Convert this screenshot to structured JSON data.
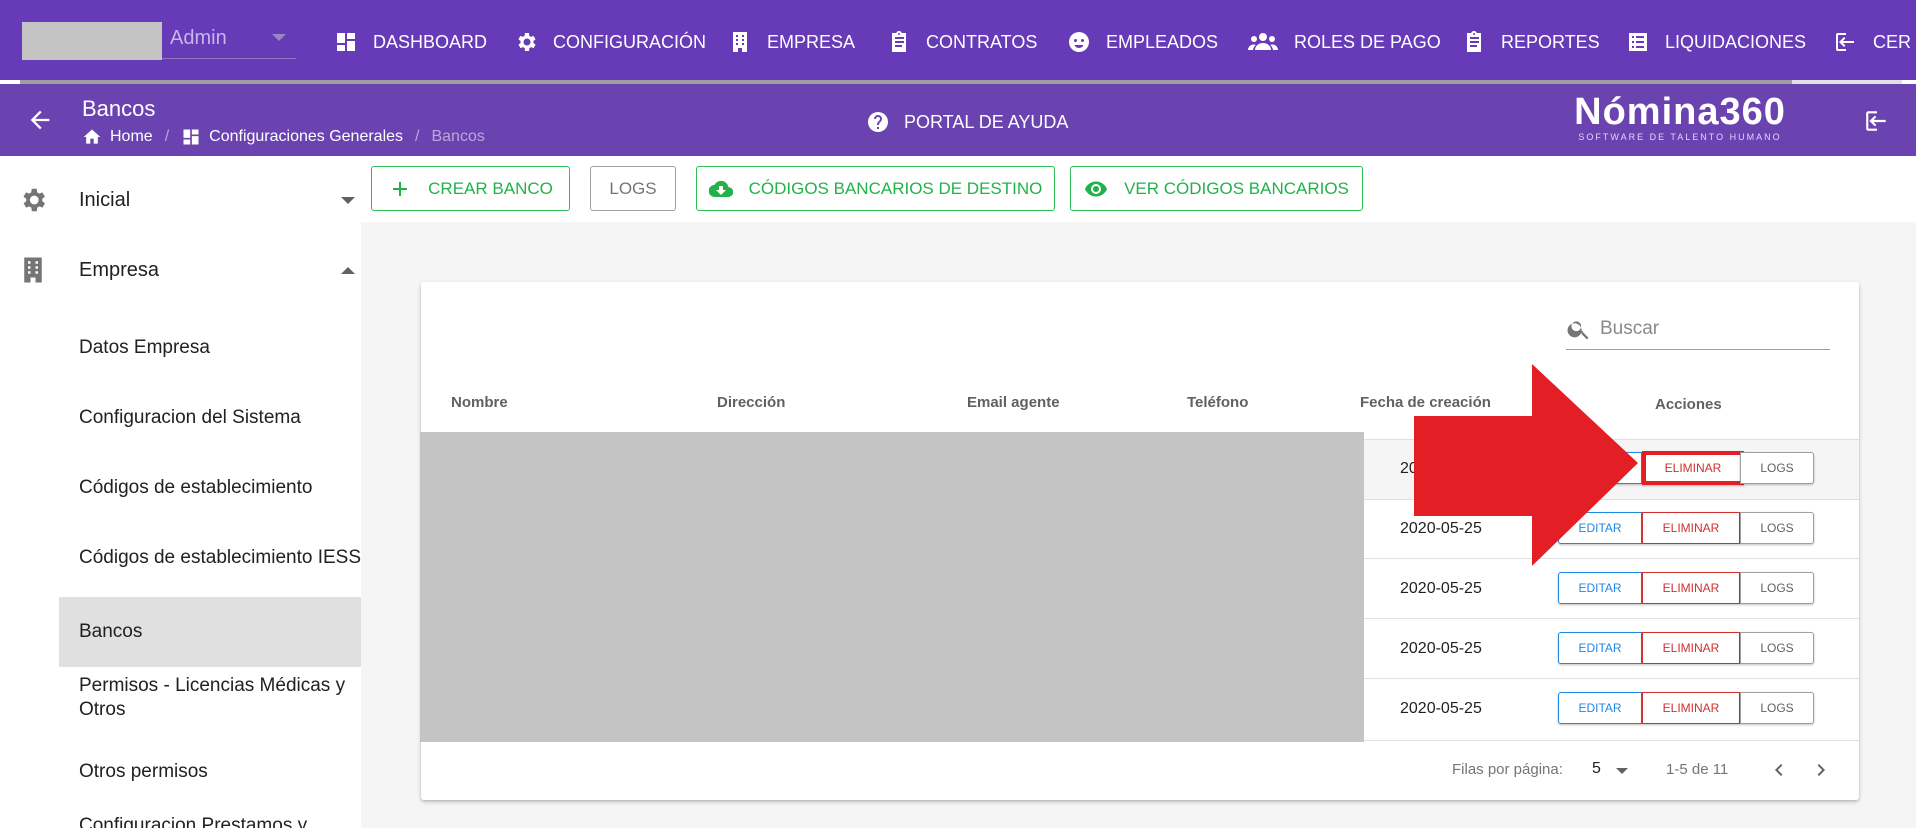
{
  "topnav": {
    "user_role": "Admin",
    "items": [
      {
        "label": "DASHBOARD",
        "icon": "dashboard-icon"
      },
      {
        "label": "CONFIGURACIÓN",
        "icon": "gear-icon"
      },
      {
        "label": "EMPRESA",
        "icon": "building-icon"
      },
      {
        "label": "CONTRATOS",
        "icon": "clipboard-icon"
      },
      {
        "label": "EMPLEADOS",
        "icon": "face-icon"
      },
      {
        "label": "ROLES DE PAGO",
        "icon": "people-icon"
      },
      {
        "label": "REPORTES",
        "icon": "clipboard-icon"
      },
      {
        "label": "LIQUIDACIONES",
        "icon": "list-icon"
      },
      {
        "label": "CER",
        "icon": "logout-icon"
      }
    ]
  },
  "header": {
    "title": "Bancos",
    "breadcrumbs": [
      "Home",
      "Configuraciones Generales",
      "Bancos"
    ],
    "help_label": "PORTAL DE AYUDA",
    "brand_name": "Nómina360",
    "brand_tagline": "SOFTWARE DE TALENTO HUMANO"
  },
  "sidebar": {
    "groups": [
      {
        "label": "Inicial",
        "icon": "gear-icon",
        "expanded": false
      },
      {
        "label": "Empresa",
        "icon": "building-icon",
        "expanded": true
      }
    ],
    "items": [
      "Datos Empresa",
      "Configuracion del Sistema",
      "Códigos de establecimiento",
      "Códigos de establecimiento IESS",
      "Bancos",
      "Permisos - Licencias Médicas y Otros",
      "Otros permisos",
      "Configuracion Prestamos y"
    ],
    "active_item": "Bancos"
  },
  "toolbar": {
    "create_label": "CREAR BANCO",
    "logs_label": "LOGS",
    "dest_codes_label": "CÓDIGOS BANCARIOS DE DESTINO",
    "view_codes_label": "VER CÓDIGOS BANCARIOS"
  },
  "table": {
    "search_placeholder": "Buscar",
    "columns": [
      "Nombre",
      "Dirección",
      "Email agente",
      "Teléfono",
      "Fecha de creación",
      "Acciones"
    ],
    "rows": [
      {
        "fecha": "20"
      },
      {
        "fecha": "2020-05-25"
      },
      {
        "fecha": "2020-05-25"
      },
      {
        "fecha": "2020-05-25"
      },
      {
        "fecha": "2020-05-25"
      }
    ],
    "actions": {
      "edit": "EDITAR",
      "delete": "ELIMINAR",
      "logs": "LOGS"
    },
    "footer": {
      "rows_per_page_label": "Filas por página:",
      "rows_per_page": "5",
      "range": "1-5 de 11"
    }
  },
  "colors": {
    "nav_bg": "#673ab7",
    "header_bg": "#6b43b0",
    "green": "#23b24a",
    "edit_blue": "#1e88e5",
    "delete_red": "#d32f2f",
    "annotation_red": "#e31e24"
  }
}
